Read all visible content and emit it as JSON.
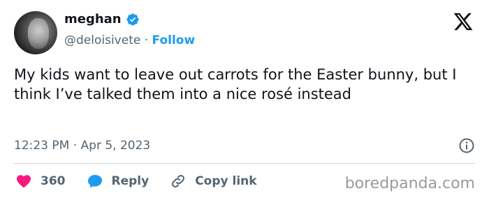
{
  "author": {
    "name": "meghan",
    "handle": "@deloisivete",
    "separator": "·",
    "follow_label": "Follow"
  },
  "tweet": {
    "text": "My kids want to leave out carrots for the Easter bunny, but I think I’ve talked them into a nice rosé instead",
    "time": "12:23 PM",
    "date": "Apr 5, 2023",
    "meta_separator": "·"
  },
  "actions": {
    "likes_count": "360",
    "reply_label": "Reply",
    "copy_link_label": "Copy link"
  },
  "watermark": "boredpanda.com",
  "icons": {
    "verified": "verified-badge-icon",
    "x": "x-logo-icon",
    "info": "info-icon",
    "like": "heart-icon",
    "reply": "reply-bubble-icon",
    "link": "link-icon"
  },
  "colors": {
    "accent": "#1d9bf0",
    "like": "#f91880",
    "text": "#0f1419",
    "muted": "#536471"
  }
}
